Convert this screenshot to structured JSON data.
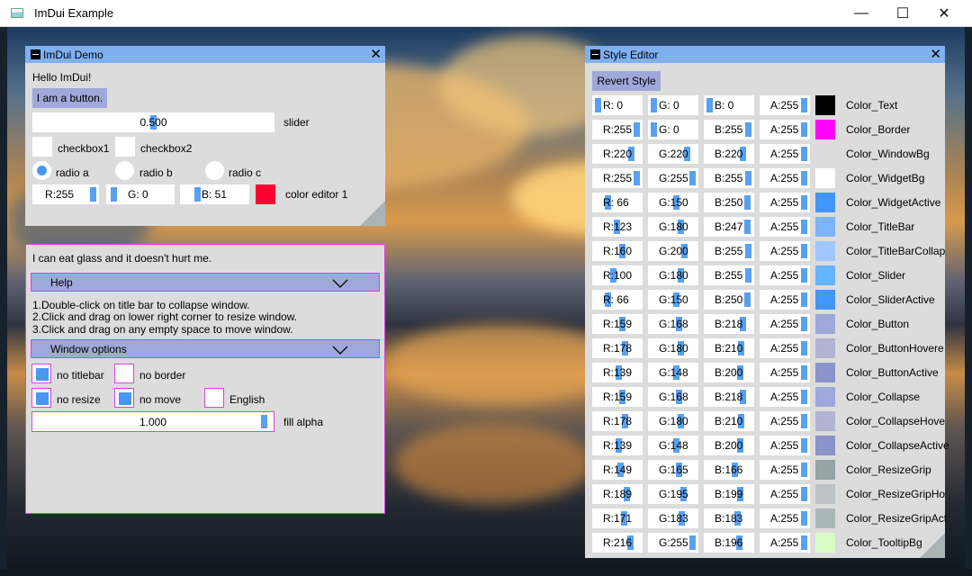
{
  "window": {
    "title": "ImDui Example",
    "min": "—",
    "max": "☐",
    "close": "✕"
  },
  "demo": {
    "title": "ImDui Demo",
    "hello": "Hello ImDui!",
    "button": "I am a button.",
    "slider_value": "0.500",
    "slider_fraction": 0.5,
    "slider_label": "slider",
    "checkbox1": "checkbox1",
    "checkbox2": "checkbox2",
    "radio_a": "radio a",
    "radio_b": "radio b",
    "radio_c": "radio c",
    "color": {
      "r": "R:255",
      "g": "G:  0",
      "b": "B: 51",
      "swatch": "#ff0033"
    },
    "color_label": "color editor 1"
  },
  "window2": {
    "text": "I can eat glass and it doesn't hurt me.",
    "help_header": "Help",
    "help_lines": [
      "1.Double-click on title bar to collapse window.",
      "2.Click and drag on lower right corner to resize window.",
      "3.Click and drag on any empty space to move window."
    ],
    "options_header": "Window options",
    "no_titlebar": "no titlebar",
    "no_border": "no border",
    "no_resize": "no resize",
    "no_move": "no move",
    "english": "English",
    "alpha_value": "1.000",
    "alpha_label": "fill alpha"
  },
  "style_editor": {
    "title": "Style Editor",
    "revert": "Revert Style",
    "rows": [
      {
        "r": "R:  0",
        "g": "G:  0",
        "b": "B:  0",
        "a": "A:255",
        "rv": 0,
        "gv": 0,
        "bv": 0,
        "av": 255,
        "color": "#000000",
        "name": "Color_Text"
      },
      {
        "r": "R:255",
        "g": "G:  0",
        "b": "B:255",
        "a": "A:255",
        "rv": 255,
        "gv": 0,
        "bv": 255,
        "av": 255,
        "color": "#ff00ff",
        "name": "Color_Border"
      },
      {
        "r": "R:220",
        "g": "G:220",
        "b": "B:220",
        "a": "A:255",
        "rv": 220,
        "gv": 220,
        "bv": 220,
        "av": 255,
        "color": "#dcdcdc",
        "name": "Color_WindowBg"
      },
      {
        "r": "R:255",
        "g": "G:255",
        "b": "B:255",
        "a": "A:255",
        "rv": 255,
        "gv": 255,
        "bv": 255,
        "av": 255,
        "color": "#ffffff",
        "name": "Color_WidgetBg"
      },
      {
        "r": "R: 66",
        "g": "G:150",
        "b": "B:250",
        "a": "A:255",
        "rv": 66,
        "gv": 150,
        "bv": 250,
        "av": 255,
        "color": "#4296fa",
        "name": "Color_WidgetActive"
      },
      {
        "r": "R:123",
        "g": "G:180",
        "b": "B:247",
        "a": "A:255",
        "rv": 123,
        "gv": 180,
        "bv": 247,
        "av": 255,
        "color": "#7bb4f7",
        "name": "Color_TitleBar"
      },
      {
        "r": "R:160",
        "g": "G:200",
        "b": "B:255",
        "a": "A:255",
        "rv": 160,
        "gv": 200,
        "bv": 255,
        "av": 255,
        "color": "#a0c8ff",
        "name": "Color_TitleBarCollap"
      },
      {
        "r": "R:100",
        "g": "G:180",
        "b": "B:255",
        "a": "A:255",
        "rv": 100,
        "gv": 180,
        "bv": 255,
        "av": 255,
        "color": "#64b4ff",
        "name": "Color_Slider"
      },
      {
        "r": "R: 66",
        "g": "G:150",
        "b": "B:250",
        "a": "A:255",
        "rv": 66,
        "gv": 150,
        "bv": 250,
        "av": 255,
        "color": "#4296fa",
        "name": "Color_SliderActive"
      },
      {
        "r": "R:159",
        "g": "G:168",
        "b": "B:218",
        "a": "A:255",
        "rv": 159,
        "gv": 168,
        "bv": 218,
        "av": 255,
        "color": "#9fa8da",
        "name": "Color_Button"
      },
      {
        "r": "R:178",
        "g": "G:180",
        "b": "B:210",
        "a": "A:255",
        "rv": 178,
        "gv": 180,
        "bv": 210,
        "av": 255,
        "color": "#b2b4d2",
        "name": "Color_ButtonHovere"
      },
      {
        "r": "R:139",
        "g": "G:148",
        "b": "B:200",
        "a": "A:255",
        "rv": 139,
        "gv": 148,
        "bv": 200,
        "av": 255,
        "color": "#8b94c8",
        "name": "Color_ButtonActive"
      },
      {
        "r": "R:159",
        "g": "G:168",
        "b": "B:218",
        "a": "A:255",
        "rv": 159,
        "gv": 168,
        "bv": 218,
        "av": 255,
        "color": "#9fa8da",
        "name": "Color_Collapse"
      },
      {
        "r": "R:178",
        "g": "G:180",
        "b": "B:210",
        "a": "A:255",
        "rv": 178,
        "gv": 180,
        "bv": 210,
        "av": 255,
        "color": "#b2b4d2",
        "name": "Color_CollapseHove"
      },
      {
        "r": "R:139",
        "g": "G:148",
        "b": "B:200",
        "a": "A:255",
        "rv": 139,
        "gv": 148,
        "bv": 200,
        "av": 255,
        "color": "#8b94c8",
        "name": "Color_CollapseActive"
      },
      {
        "r": "R:149",
        "g": "G:165",
        "b": "B:166",
        "a": "A:255",
        "rv": 149,
        "gv": 165,
        "bv": 166,
        "av": 255,
        "color": "#95a5a6",
        "name": "Color_ResizeGrip"
      },
      {
        "r": "R:189",
        "g": "G:195",
        "b": "B:199",
        "a": "A:255",
        "rv": 189,
        "gv": 195,
        "bv": 199,
        "av": 255,
        "color": "#bdc3c7",
        "name": "Color_ResizeGripHo"
      },
      {
        "r": "R:171",
        "g": "G:183",
        "b": "B:183",
        "a": "A:255",
        "rv": 171,
        "gv": 183,
        "bv": 183,
        "av": 255,
        "color": "#abb7b7",
        "name": "Color_ResizeGripAct"
      },
      {
        "r": "R:216",
        "g": "G:255",
        "b": "B:196",
        "a": "A:255",
        "rv": 216,
        "gv": 255,
        "bv": 196,
        "av": 255,
        "color": "#d8ffc4",
        "name": "Color_TooltipBg"
      }
    ]
  }
}
